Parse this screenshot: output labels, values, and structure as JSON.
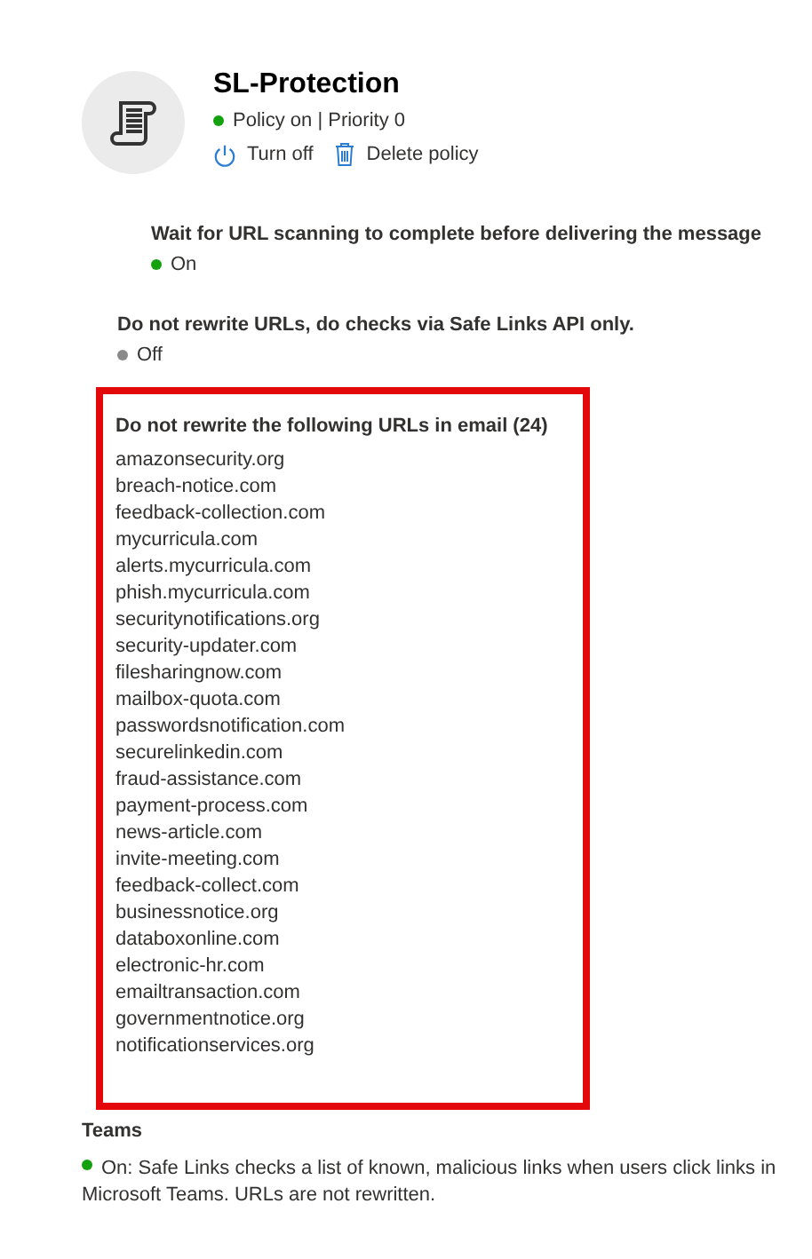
{
  "policy": {
    "title": "SL-Protection",
    "status": {
      "on": true,
      "text": "Policy on | Priority 0"
    },
    "actions": [
      {
        "kind": "power",
        "label": "Turn off"
      },
      {
        "kind": "delete",
        "label": "Delete policy"
      }
    ]
  },
  "settings": [
    {
      "label": "Wait for URL scanning to complete before delivering the message",
      "on": true,
      "value": "On",
      "indented": true
    },
    {
      "label": "Do not rewrite URLs, do checks via Safe Links API only.",
      "on": false,
      "value": "Off",
      "indented": false
    }
  ],
  "url_list": {
    "heading": "Do not rewrite the following URLs in email (24)",
    "highlighted": true,
    "urls": [
      "amazonsecurity.org",
      "breach-notice.com",
      "feedback-collection.com",
      "mycurricula.com",
      "alerts.mycurricula.com",
      "phish.mycurricula.com",
      "securitynotifications.org",
      "security-updater.com",
      "filesharingnow.com",
      "mailbox-quota.com",
      "passwordsnotification.com",
      "securelinkedin.com",
      "fraud-assistance.com",
      "payment-process.com",
      "news-article.com",
      "invite-meeting.com",
      "feedback-collect.com",
      "businessnotice.org",
      "databoxonline.com",
      "electronic-hr.com",
      "emailtransaction.com",
      "governmentnotice.org",
      "notificationservices.org"
    ]
  },
  "teams": {
    "heading": "Teams",
    "on": true,
    "text": "On: Safe Links checks a list of known, malicious links when users click links in Microsoft Teams. URLs are not rewritten."
  }
}
